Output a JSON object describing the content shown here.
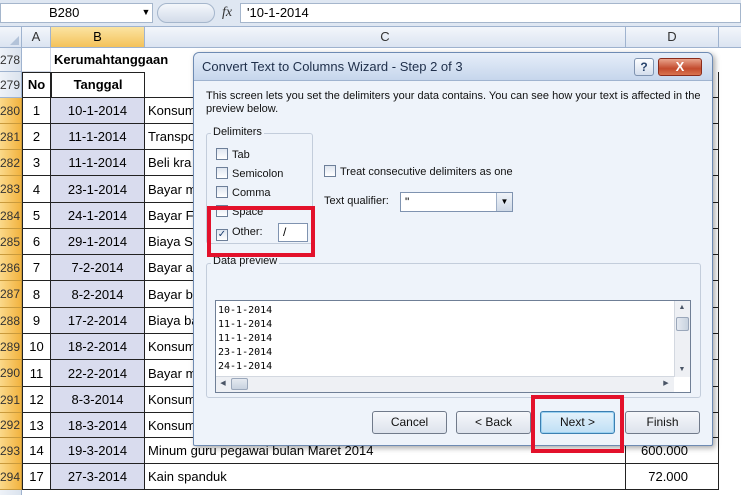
{
  "formula_bar": {
    "name_box": "B280",
    "fx": "fx",
    "formula": "'10-1-2014",
    "icons": [
      "dropdown-arrow-icon",
      "function-icon"
    ]
  },
  "columns": [
    "A",
    "B",
    "C",
    "D"
  ],
  "sheet": {
    "title": "Kerumahtanggaan",
    "headers": {
      "no": "No",
      "date": "Tanggal"
    },
    "row_numbers": [
      "278",
      "279",
      "280",
      "281",
      "282",
      "283",
      "284",
      "285",
      "286",
      "287",
      "288",
      "289",
      "290",
      "291",
      "292",
      "293",
      "294",
      "295"
    ],
    "rows": [
      {
        "no": "1",
        "date": "10-1-2014",
        "desc": "Konsum",
        "amount": ""
      },
      {
        "no": "2",
        "date": "11-1-2014",
        "desc": "Transpo",
        "amount": ""
      },
      {
        "no": "3",
        "date": "11-1-2014",
        "desc": "Beli kra",
        "amount": ""
      },
      {
        "no": "4",
        "date": "23-1-2014",
        "desc": "Bayar m",
        "amount": ""
      },
      {
        "no": "5",
        "date": "24-1-2014",
        "desc": "Bayar Fo",
        "amount": ""
      },
      {
        "no": "6",
        "date": "29-1-2014",
        "desc": "Biaya Se",
        "amount": ""
      },
      {
        "no": "7",
        "date": "7-2-2014",
        "desc": "Bayar ai",
        "amount": ""
      },
      {
        "no": "8",
        "date": "8-2-2014",
        "desc": "Bayar bi",
        "amount": ""
      },
      {
        "no": "9",
        "date": "17-2-2014",
        "desc": "Biaya ba",
        "amount": ""
      },
      {
        "no": "10",
        "date": "18-2-2014",
        "desc": "Konsum",
        "amount": ""
      },
      {
        "no": "11",
        "date": "22-2-2014",
        "desc": "Bayar m",
        "amount": ""
      },
      {
        "no": "12",
        "date": "8-3-2014",
        "desc": "Konsum",
        "amount": ""
      },
      {
        "no": "13",
        "date": "18-3-2014",
        "desc": "Konsum",
        "amount": ""
      },
      {
        "no": "14",
        "date": "19-3-2014",
        "desc": "Minum guru pegawai bulan Maret 2014",
        "amount": "600.000"
      },
      {
        "no": "17",
        "date": "27-3-2014",
        "desc": "Kain spanduk",
        "amount": "72.000"
      }
    ]
  },
  "dialog": {
    "title": "Convert Text to Columns Wizard - Step 2 of 3",
    "help": "?",
    "close": "X",
    "description": "This screen lets you set the delimiters your data contains.  You can see how your text is affected in the preview below.",
    "delimiters_label": "Delimiters",
    "delimiters": [
      {
        "label": "Tab",
        "checked": false
      },
      {
        "label": "Semicolon",
        "checked": false
      },
      {
        "label": "Comma",
        "checked": false
      },
      {
        "label": "Space",
        "checked": false
      },
      {
        "label": "Other:",
        "checked": true
      }
    ],
    "check_mark": "✓",
    "other_value": "/",
    "consecutive_label": "Treat consecutive delimiters as one",
    "text_qualifier_label": "Text qualifier:",
    "text_qualifier_value": "\"",
    "preview_label": "Data preview",
    "preview_lines": [
      "10-1-2014",
      "11-1-2014",
      "11-1-2014",
      "23-1-2014",
      "24-1-2014"
    ],
    "buttons": {
      "cancel": "Cancel",
      "back": "< Back",
      "next": "Next >",
      "finish": "Finish"
    }
  },
  "highlight_color": "#e3112b"
}
